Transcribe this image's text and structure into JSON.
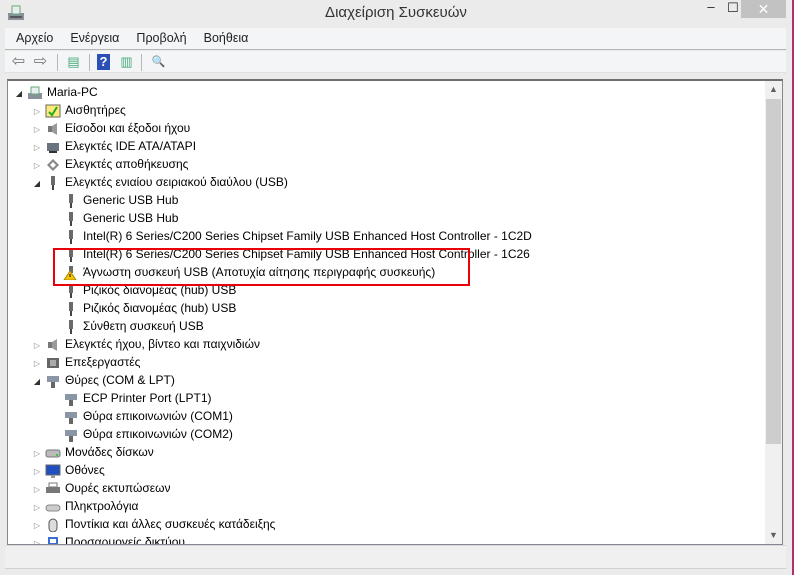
{
  "window": {
    "title": "Διαχείριση Συσκευών",
    "minimize": "–",
    "maximize": "☐",
    "close": "✕"
  },
  "menu": [
    "Αρχείο",
    "Ενέργεια",
    "Προβολή",
    "Βοήθεια"
  ],
  "toolbar": [
    {
      "icon": "back-icon",
      "glyph": "⇦"
    },
    {
      "icon": "forward-icon",
      "glyph": "⇨"
    },
    {
      "icon": "show-hide-console-tree-icon",
      "glyph": "▤"
    },
    {
      "icon": "help-icon",
      "glyph": "?"
    },
    {
      "icon": "action-pane-icon",
      "glyph": "▥"
    },
    {
      "icon": "scan-hardware-icon",
      "glyph": "🔍"
    }
  ],
  "tree": [
    {
      "label": "Maria-PC",
      "level": 0,
      "state": "open",
      "icon": "computer"
    },
    {
      "label": "Αισθητήρες",
      "level": 1,
      "state": "closed",
      "icon": "sensor"
    },
    {
      "label": "Είσοδοι και έξοδοι ήχου",
      "level": 1,
      "state": "closed",
      "icon": "speaker"
    },
    {
      "label": "Ελεγκτές IDE ATA/ATAPI",
      "level": 1,
      "state": "closed",
      "icon": "ide"
    },
    {
      "label": "Ελεγκτές αποθήκευσης",
      "level": 1,
      "state": "closed",
      "icon": "storage"
    },
    {
      "label": "Ελεγκτές ενιαίου σειριακού διαύλου (USB)",
      "level": 1,
      "state": "open",
      "icon": "usb"
    },
    {
      "label": "Generic USB Hub",
      "level": 2,
      "icon": "usb"
    },
    {
      "label": "Generic USB Hub",
      "level": 2,
      "icon": "usb"
    },
    {
      "label": "Intel(R) 6 Series/C200 Series Chipset Family USB Enhanced Host Controller - 1C2D",
      "level": 2,
      "icon": "usb"
    },
    {
      "label": "Intel(R) 6 Series/C200 Series Chipset Family USB Enhanced Host Controller - 1C26",
      "level": 2,
      "icon": "usb"
    },
    {
      "label": "Άγνωστη συσκευή USB (Αποτυχία αίτησης περιγραφής συσκευής)",
      "level": 2,
      "icon": "usb-warning"
    },
    {
      "label": "Ριζικός διανομέας (hub) USB",
      "level": 2,
      "icon": "usb"
    },
    {
      "label": "Ριζικός διανομέας (hub) USB",
      "level": 2,
      "icon": "usb"
    },
    {
      "label": "Σύνθετη συσκευή USB",
      "level": 2,
      "icon": "usb"
    },
    {
      "label": "Ελεγκτές ήχου, βίντεο και παιχνιδιών",
      "level": 1,
      "state": "closed",
      "icon": "speaker"
    },
    {
      "label": "Επεξεργαστές",
      "level": 1,
      "state": "closed",
      "icon": "cpu"
    },
    {
      "label": "Θύρες (COM & LPT)",
      "level": 1,
      "state": "open",
      "icon": "port"
    },
    {
      "label": "ECP Printer Port (LPT1)",
      "level": 2,
      "icon": "port"
    },
    {
      "label": "Θύρα επικοινωνιών (COM1)",
      "level": 2,
      "icon": "port"
    },
    {
      "label": "Θύρα επικοινωνιών (COM2)",
      "level": 2,
      "icon": "port"
    },
    {
      "label": "Μονάδες δίσκων",
      "level": 1,
      "state": "closed",
      "icon": "disk"
    },
    {
      "label": "Οθόνες",
      "level": 1,
      "state": "closed",
      "icon": "monitor"
    },
    {
      "label": "Ουρές εκτυπώσεων",
      "level": 1,
      "state": "closed",
      "icon": "printer"
    },
    {
      "label": "Πληκτρολόγια",
      "level": 1,
      "state": "closed",
      "icon": "keyboard"
    },
    {
      "label": "Ποντίκια και άλλες συσκευές κατάδειξης",
      "level": 1,
      "state": "closed",
      "icon": "mouse"
    },
    {
      "label": "Προσαρμογείς δικτύου",
      "level": 1,
      "state": "closed",
      "icon": "network"
    }
  ]
}
